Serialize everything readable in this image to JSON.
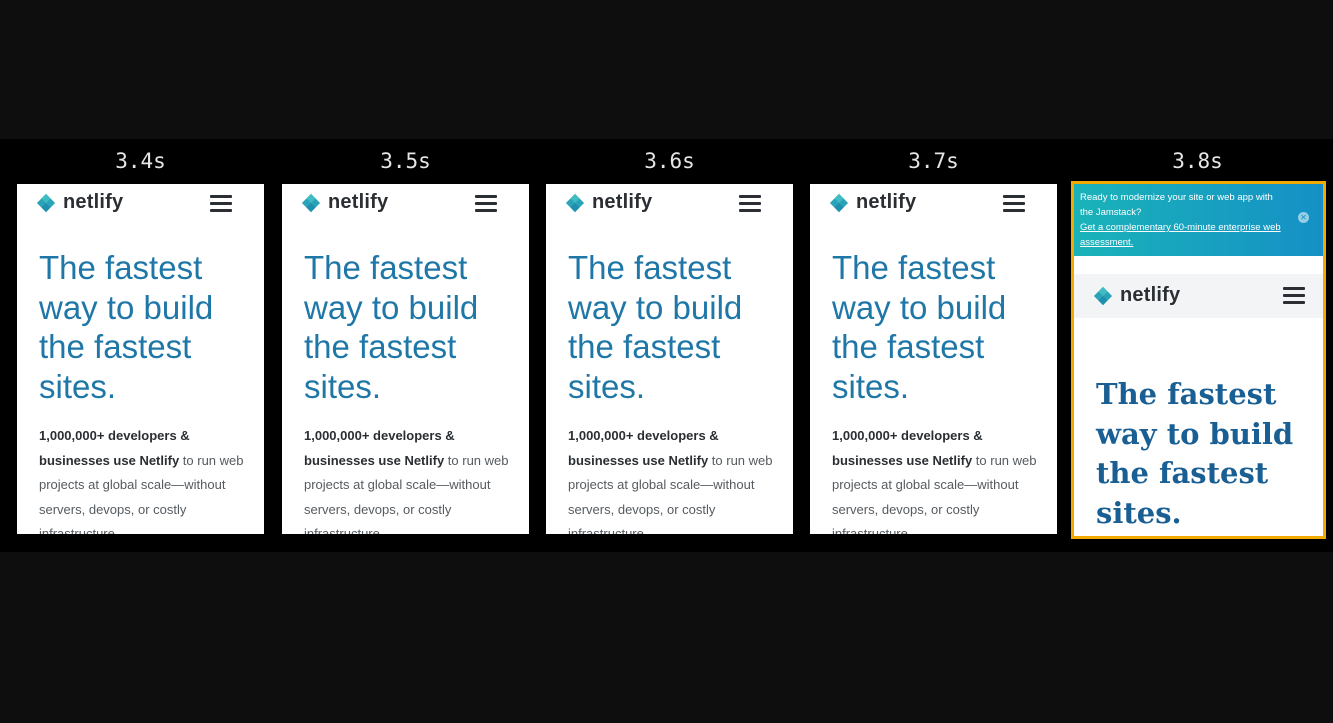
{
  "frames": [
    {
      "time": "3.4s",
      "brand": "netlify",
      "hero": "The fastest way to build the fastest sites.",
      "desc_bold": "1,000,000+ developers & businesses use Netlify",
      "desc_rest": " to run web projects at global scale—without servers, devops, or costly infrastructure."
    },
    {
      "time": "3.5s",
      "brand": "netlify",
      "hero": "The fastest way to build the fastest sites.",
      "desc_bold": "1,000,000+ developers & businesses use Netlify",
      "desc_rest": " to run web projects at global scale—without servers, devops, or costly infrastructure."
    },
    {
      "time": "3.6s",
      "brand": "netlify",
      "hero": "The fastest way to build the fastest sites.",
      "desc_bold": "1,000,000+ developers & businesses use Netlify",
      "desc_rest": " to run web projects at global scale—without servers, devops, or costly infrastructure."
    },
    {
      "time": "3.7s",
      "brand": "netlify",
      "hero": "The fastest way to build the fastest sites.",
      "desc_bold": "1,000,000+ developers & businesses use Netlify",
      "desc_rest": " to run web projects at global scale—without servers, devops, or costly infrastructure."
    }
  ],
  "last_frame": {
    "time": "3.8s",
    "banner_text": "Ready to modernize your site or web app with the Jamstack?",
    "banner_link": "Get a complementary 60-minute enterprise web assessment.",
    "brand": "netlify",
    "hero": "The fastest way to build the fastest sites."
  },
  "colors": {
    "accent": "#1f77a8",
    "highlight": "#f2a900",
    "banner": "#1590c6"
  }
}
